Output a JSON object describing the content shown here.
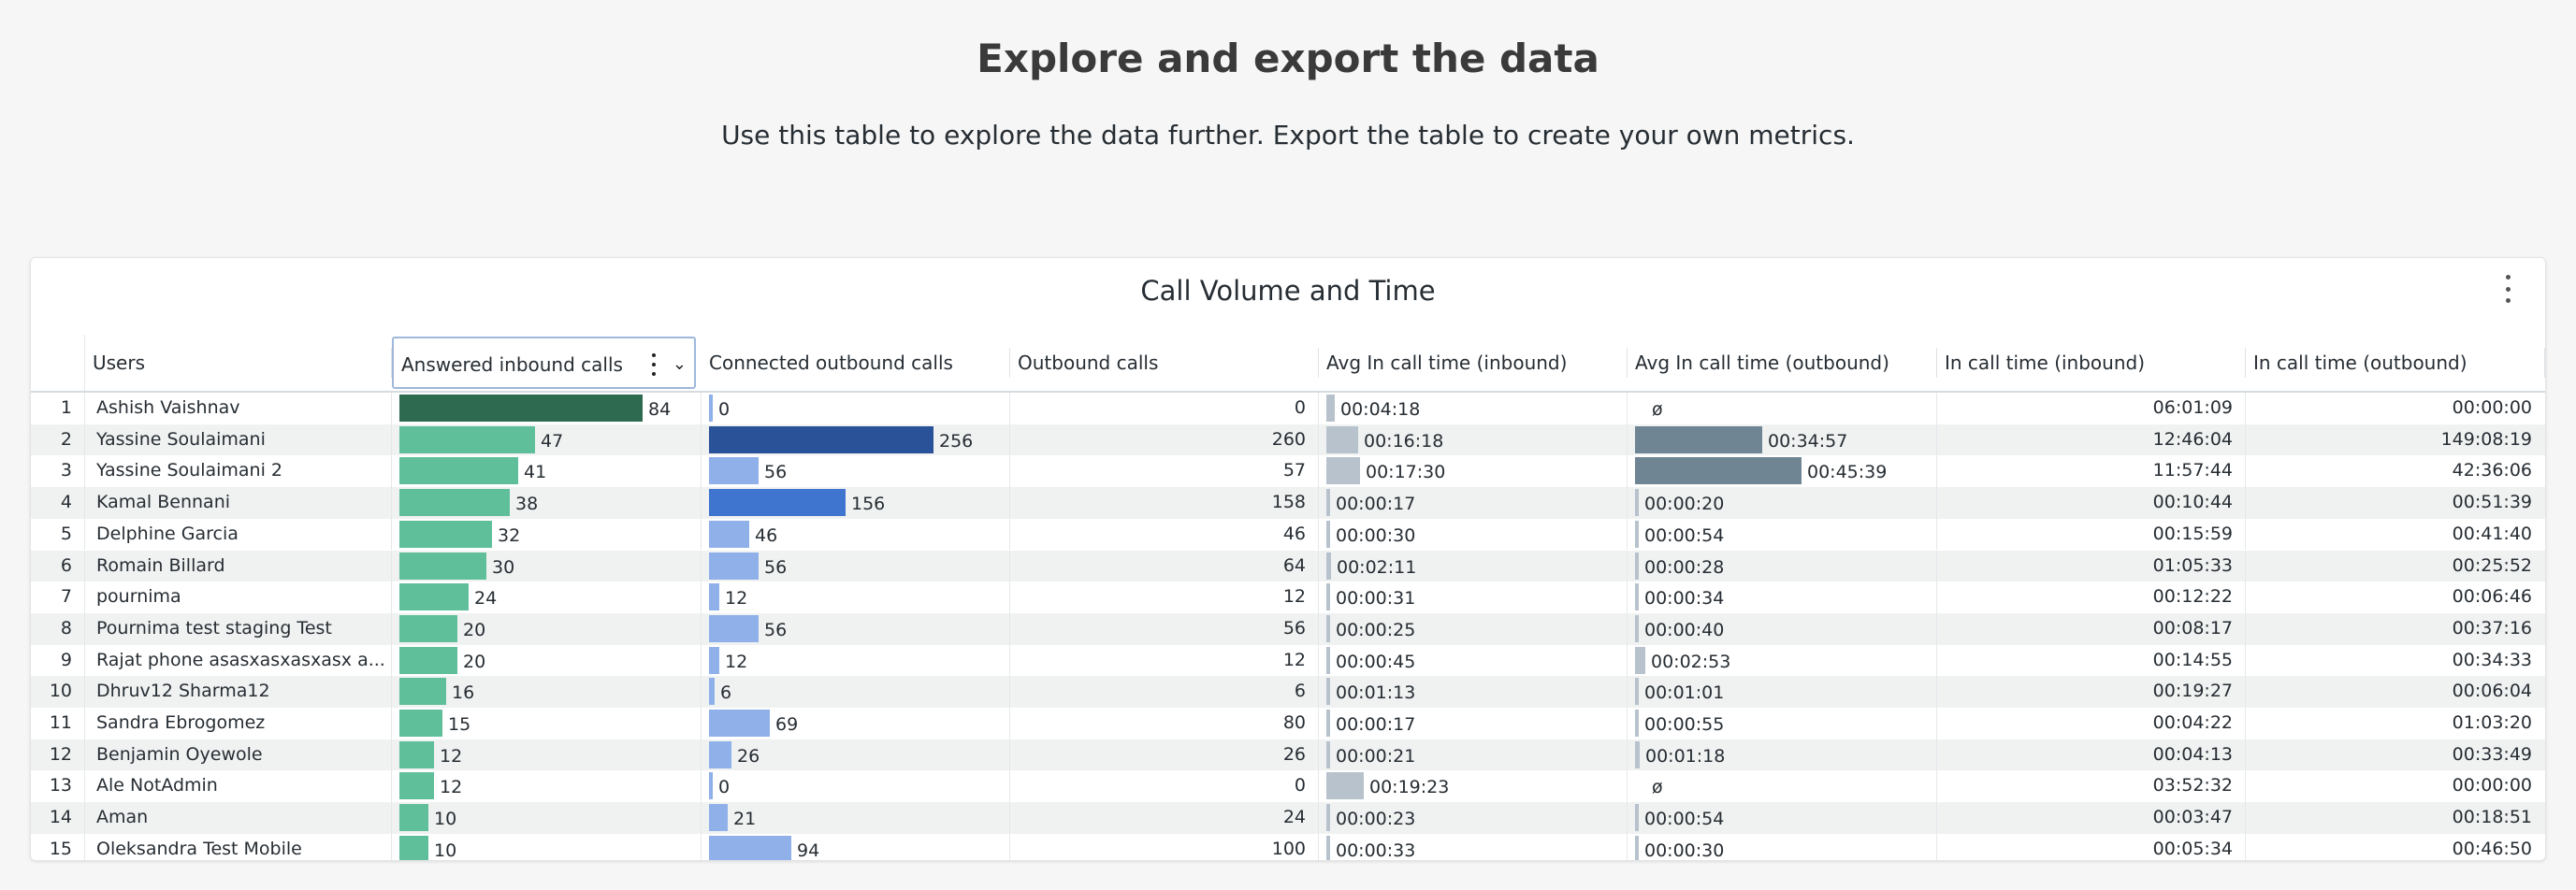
{
  "page": {
    "title": "Explore and export the data",
    "subtitle": "Use this table to explore the data further. Export the table to create your own metrics."
  },
  "card": {
    "title": "Call Volume and Time",
    "menu_icon": "vertical-dots-icon"
  },
  "columns": [
    "Users",
    "Answered inbound calls",
    "Connected outbound calls",
    "Outbound calls",
    "Avg In call time (inbound)",
    "Avg In call time (outbound)",
    "In call time (inbound)",
    "In call time (outbound)"
  ],
  "selected_column": "Answered inbound calls",
  "colors": {
    "inbound_bar_max": "#2d6a4f",
    "inbound_bar": "#5fbf9a",
    "outbound_bar_max": "#2a5298",
    "outbound_bar": "#8fb0e8",
    "avg_bar": "#b8c2cc",
    "avg_bar_dark": "#6f8593"
  },
  "rows": [
    {
      "index": "1",
      "user": "Ashish Vaishnav",
      "answered_inbound": "84",
      "connected_outbound": "0",
      "outbound_calls": "0",
      "avg_in_inbound": "00:04:18",
      "avg_in_outbound": "ø",
      "in_call_inbound": "06:01:09",
      "in_call_outbound": "00:00:00"
    },
    {
      "index": "2",
      "user": "Yassine Soulaimani",
      "answered_inbound": "47",
      "connected_outbound": "256",
      "outbound_calls": "260",
      "avg_in_inbound": "00:16:18",
      "avg_in_outbound": "00:34:57",
      "in_call_inbound": "12:46:04",
      "in_call_outbound": "149:08:19"
    },
    {
      "index": "3",
      "user": "Yassine Soulaimani 2",
      "answered_inbound": "41",
      "connected_outbound": "56",
      "outbound_calls": "57",
      "avg_in_inbound": "00:17:30",
      "avg_in_outbound": "00:45:39",
      "in_call_inbound": "11:57:44",
      "in_call_outbound": "42:36:06"
    },
    {
      "index": "4",
      "user": "Kamal Bennani",
      "answered_inbound": "38",
      "connected_outbound": "156",
      "outbound_calls": "158",
      "avg_in_inbound": "00:00:17",
      "avg_in_outbound": "00:00:20",
      "in_call_inbound": "00:10:44",
      "in_call_outbound": "00:51:39"
    },
    {
      "index": "5",
      "user": "Delphine Garcia",
      "answered_inbound": "32",
      "connected_outbound": "46",
      "outbound_calls": "46",
      "avg_in_inbound": "00:00:30",
      "avg_in_outbound": "00:00:54",
      "in_call_inbound": "00:15:59",
      "in_call_outbound": "00:41:40"
    },
    {
      "index": "6",
      "user": "Romain Billard",
      "answered_inbound": "30",
      "connected_outbound": "56",
      "outbound_calls": "64",
      "avg_in_inbound": "00:02:11",
      "avg_in_outbound": "00:00:28",
      "in_call_inbound": "01:05:33",
      "in_call_outbound": "00:25:52"
    },
    {
      "index": "7",
      "user": "pournima",
      "answered_inbound": "24",
      "connected_outbound": "12",
      "outbound_calls": "12",
      "avg_in_inbound": "00:00:31",
      "avg_in_outbound": "00:00:34",
      "in_call_inbound": "00:12:22",
      "in_call_outbound": "00:06:46"
    },
    {
      "index": "8",
      "user": "Pournima test staging Test",
      "answered_inbound": "20",
      "connected_outbound": "56",
      "outbound_calls": "56",
      "avg_in_inbound": "00:00:25",
      "avg_in_outbound": "00:00:40",
      "in_call_inbound": "00:08:17",
      "in_call_outbound": "00:37:16"
    },
    {
      "index": "9",
      "user": "Rajat phone asasxasxasxasx a...",
      "answered_inbound": "20",
      "connected_outbound": "12",
      "outbound_calls": "12",
      "avg_in_inbound": "00:00:45",
      "avg_in_outbound": "00:02:53",
      "in_call_inbound": "00:14:55",
      "in_call_outbound": "00:34:33"
    },
    {
      "index": "10",
      "user": "Dhruv12 Sharma12",
      "answered_inbound": "16",
      "connected_outbound": "6",
      "outbound_calls": "6",
      "avg_in_inbound": "00:01:13",
      "avg_in_outbound": "00:01:01",
      "in_call_inbound": "00:19:27",
      "in_call_outbound": "00:06:04"
    },
    {
      "index": "11",
      "user": "Sandra Ebrogomez",
      "answered_inbound": "15",
      "connected_outbound": "69",
      "outbound_calls": "80",
      "avg_in_inbound": "00:00:17",
      "avg_in_outbound": "00:00:55",
      "in_call_inbound": "00:04:22",
      "in_call_outbound": "01:03:20"
    },
    {
      "index": "12",
      "user": "Benjamin Oyewole",
      "answered_inbound": "12",
      "connected_outbound": "26",
      "outbound_calls": "26",
      "avg_in_inbound": "00:00:21",
      "avg_in_outbound": "00:01:18",
      "in_call_inbound": "00:04:13",
      "in_call_outbound": "00:33:49"
    },
    {
      "index": "13",
      "user": "Ale NotAdmin",
      "answered_inbound": "12",
      "connected_outbound": "0",
      "outbound_calls": "0",
      "avg_in_inbound": "00:19:23",
      "avg_in_outbound": "ø",
      "in_call_inbound": "03:52:32",
      "in_call_outbound": "00:00:00"
    },
    {
      "index": "14",
      "user": "Aman",
      "answered_inbound": "10",
      "connected_outbound": "21",
      "outbound_calls": "24",
      "avg_in_inbound": "00:00:23",
      "avg_in_outbound": "00:00:54",
      "in_call_inbound": "00:03:47",
      "in_call_outbound": "00:18:51"
    },
    {
      "index": "15",
      "user": "Oleksandra Test Mobile",
      "answered_inbound": "10",
      "connected_outbound": "94",
      "outbound_calls": "100",
      "avg_in_inbound": "00:00:33",
      "avg_in_outbound": "00:00:30",
      "in_call_inbound": "00:05:34",
      "in_call_outbound": "00:46:50"
    }
  ]
}
